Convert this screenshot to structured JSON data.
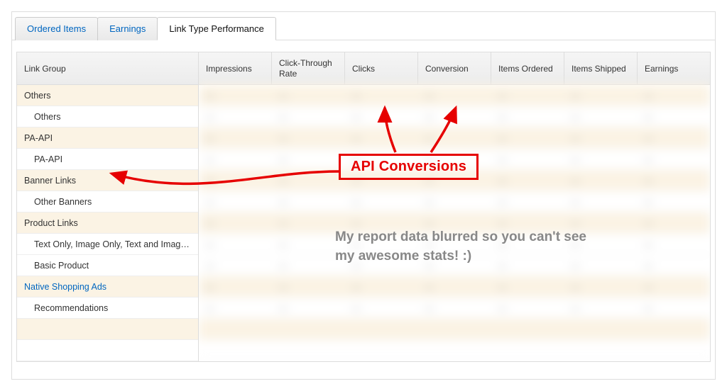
{
  "tabs": {
    "ordered_items": "Ordered Items",
    "earnings": "Earnings",
    "link_type_performance": "Link Type Performance"
  },
  "columns": {
    "link_group": "Link Group",
    "impressions": "Impressions",
    "ctr": "Click-Through Rate",
    "clicks": "Clicks",
    "conversion": "Conversion",
    "items_ordered": "Items Ordered",
    "items_shipped": "Items Shipped",
    "earnings": "Earnings"
  },
  "rows": [
    {
      "kind": "parent",
      "label": "Others"
    },
    {
      "kind": "child",
      "label": "Others"
    },
    {
      "kind": "parent",
      "label": "PA-API"
    },
    {
      "kind": "child",
      "label": "PA-API"
    },
    {
      "kind": "parent",
      "label": "Banner Links"
    },
    {
      "kind": "child",
      "label": "Other Banners"
    },
    {
      "kind": "parent",
      "label": "Product Links"
    },
    {
      "kind": "child",
      "label": "Text Only, Image Only, Text and Image..."
    },
    {
      "kind": "child",
      "label": "Basic Product"
    },
    {
      "kind": "parent",
      "label": "Native Shopping Ads",
      "link": true
    },
    {
      "kind": "child",
      "label": "Recommendations"
    },
    {
      "kind": "empty",
      "label": ""
    },
    {
      "kind": "empty2",
      "label": ""
    }
  ],
  "annotations": {
    "callout": "API Conversions",
    "note": "My report data blurred so you can't see my awesome stats! :)"
  }
}
